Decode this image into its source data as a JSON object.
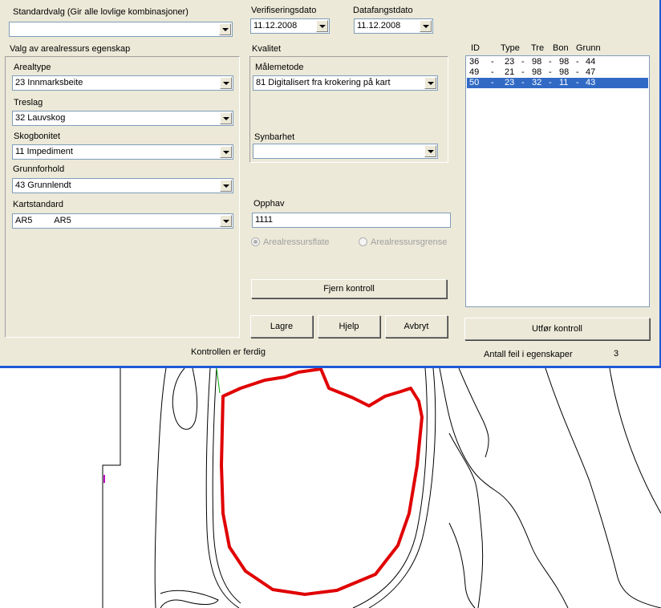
{
  "standardvalg": {
    "label": "Standardvalg (Gir alle lovlige kombinasjoner)",
    "value": ""
  },
  "verifiseringsdato": {
    "label": "Verifiseringsdato",
    "value": "11.12.2008"
  },
  "datafangstdato": {
    "label": "Datafangstdato",
    "value": "11.12.2008"
  },
  "arealressurs_group": {
    "title": "Valg av arealressurs egenskap",
    "fields": [
      {
        "label": "Arealtype",
        "value": "23 Innmarksbeite"
      },
      {
        "label": "Treslag",
        "value": "32 Lauvskog"
      },
      {
        "label": "Skogbonitet",
        "value": "11 Impediment"
      },
      {
        "label": "Grunnforhold",
        "value": "43 Grunnlendt"
      },
      {
        "label": "Kartstandard",
        "value": "AR5         AR5"
      }
    ]
  },
  "kvalitet": {
    "title": "Kvalitet",
    "malemetode": {
      "label": "Målemetode",
      "value": "81 Digitalisert fra krokering på kart"
    },
    "synbarhet": {
      "label": "Synbarhet",
      "value": ""
    }
  },
  "opphav": {
    "label": "Opphav",
    "value": "1111"
  },
  "radios": {
    "flate": "Arealressursflate",
    "grense": "Arealressursgrense"
  },
  "buttons": {
    "fjern": "Fjern kontroll",
    "lagre": "Lagre",
    "hjelp": "Hjelp",
    "avbryt": "Avbryt",
    "utfor": "Utfør kontroll"
  },
  "list": {
    "headers": [
      "ID",
      "Type",
      "Tre",
      "Bon",
      "Grunn"
    ],
    "rows": [
      {
        "id": "36",
        "type": "23",
        "tre": "98",
        "bon": "98",
        "grunn": "44",
        "selected": false
      },
      {
        "id": "49",
        "type": "21",
        "tre": "98",
        "bon": "98",
        "grunn": "47",
        "selected": false
      },
      {
        "id": "50",
        "type": "23",
        "tre": "32",
        "bon": "11",
        "grunn": "43",
        "selected": true
      }
    ]
  },
  "status": {
    "message": "Kontrollen er ferdig",
    "feil_label": "Antall feil i egenskaper",
    "feil_count": "3"
  },
  "colors": {
    "accent": "#316ac5",
    "dialog_bg": "#ece9d8",
    "map_highlight": "#e00000",
    "window_border": "#1f5ad6"
  }
}
